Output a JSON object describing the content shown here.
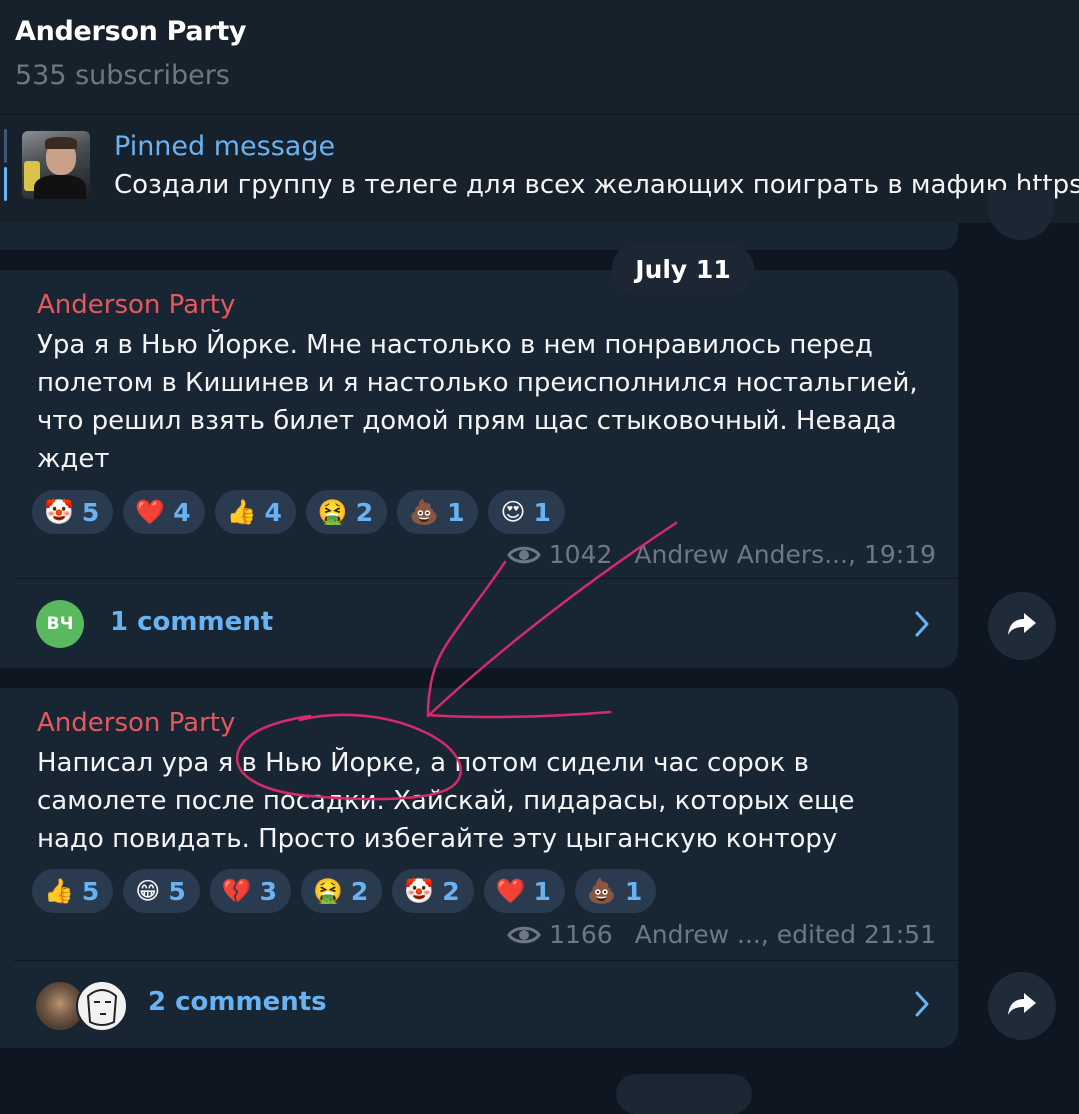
{
  "channel": {
    "title": "Anderson Party",
    "subscribers": "535 subscribers"
  },
  "pinned": {
    "title": "Pinned message",
    "text": "Создали группу в телеге для всех желающих поиграть в мафию  https:/"
  },
  "date_separator": "July 11",
  "posts": [
    {
      "author": "Anderson Party",
      "text": "Ура я в Нью Йорке. Мне настолько в нем понравилось перед полетом в Кишинев и я настолько преисполнился ностальгией, что решил взять билет домой прям щас стыковочный. Невада ждет",
      "reactions": [
        {
          "emoji": "🤡",
          "count": "5"
        },
        {
          "emoji": "❤️",
          "count": "4"
        },
        {
          "emoji": "👍",
          "count": "4"
        },
        {
          "emoji": "🤮",
          "count": "2"
        },
        {
          "emoji": "💩",
          "count": "1"
        },
        {
          "emoji": "😍",
          "count": "1"
        }
      ],
      "views": "1042",
      "signature": "Andrew Anders..., 19:19",
      "comments": {
        "avatar_initials": "ВЧ",
        "label": "1 comment"
      }
    },
    {
      "author": "Anderson Party",
      "text": "Написал ура я в Нью Йорке, а потом сидели час сорок в самолете после посадки. Хайскай, пидарасы, которых еще надо повидать. Просто избегайте эту цыганскую контору",
      "reactions": [
        {
          "emoji": "👍",
          "count": "5"
        },
        {
          "emoji": "😁",
          "count": "5"
        },
        {
          "emoji": "💔",
          "count": "3"
        },
        {
          "emoji": "🤮",
          "count": "2"
        },
        {
          "emoji": "🤡",
          "count": "2"
        },
        {
          "emoji": "❤️",
          "count": "1"
        },
        {
          "emoji": "💩",
          "count": "1"
        }
      ],
      "views": "1166",
      "signature": "Andrew ..., edited 21:51",
      "comments": {
        "label": "2 comments"
      }
    }
  ],
  "icons": {
    "views": "eye-icon",
    "share": "share-arrow-icon",
    "chevron": "chevron-right-icon"
  },
  "colors": {
    "background": "#0e1621",
    "header": "#17212b",
    "bubble": "#182533",
    "accent": "#6ab3f3",
    "author": "#e4585e",
    "annotation": "#d62b6b"
  }
}
